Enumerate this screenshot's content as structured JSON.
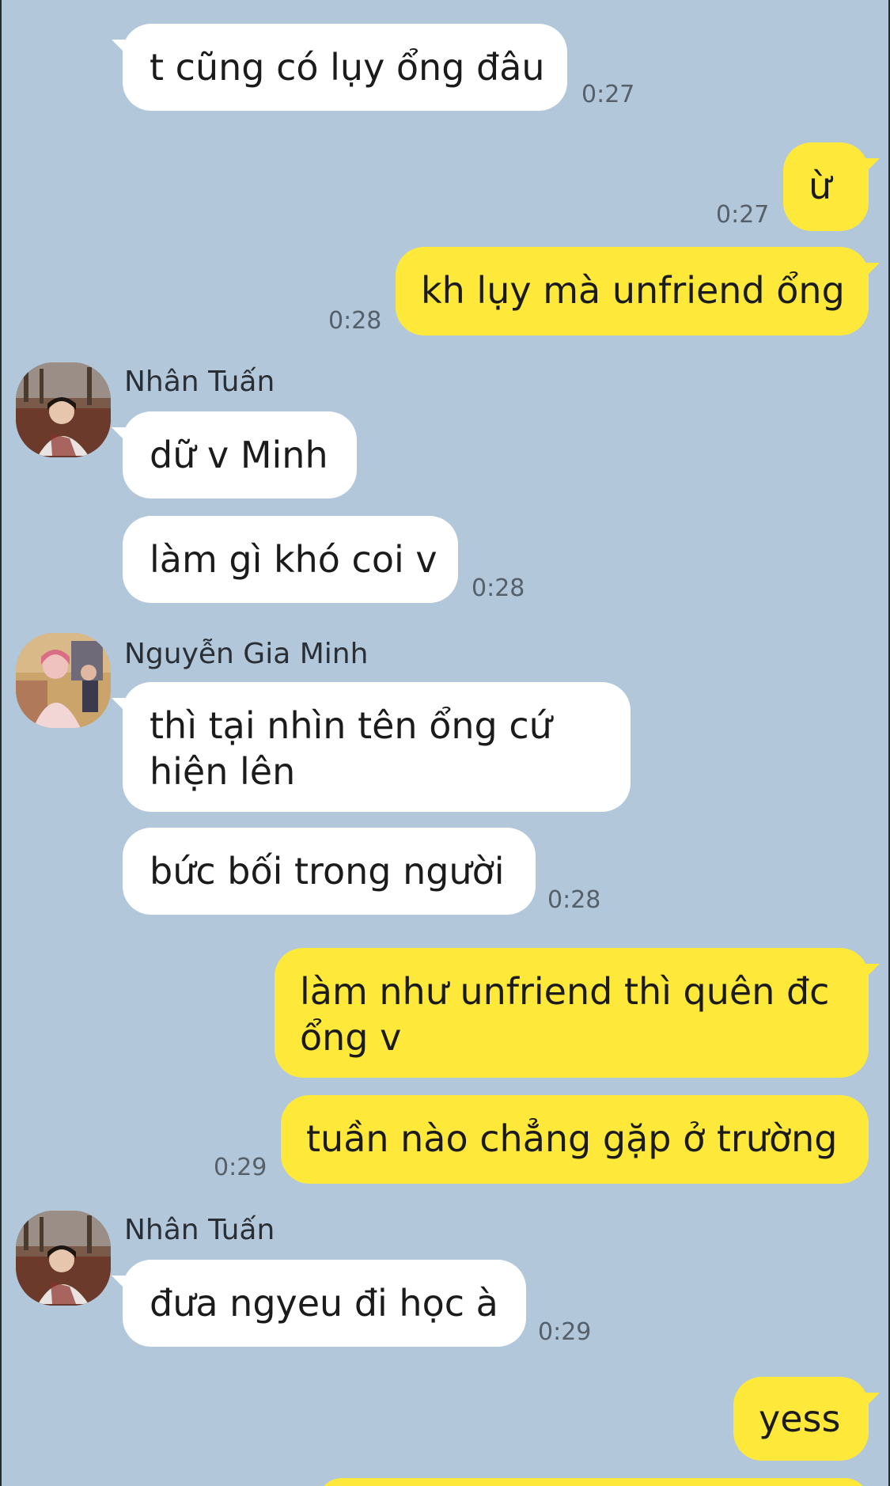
{
  "chat": {
    "messages": [
      {
        "text": "t cũng có lụy ổng đâu",
        "time": "0:27"
      },
      {
        "text": "ừ",
        "time": "0:27"
      },
      {
        "text": "kh lụy mà unfriend ổng",
        "time": "0:28"
      },
      {
        "sender": "Nhân Tuấn",
        "text": "dữ v Minh"
      },
      {
        "text": "làm gì khó coi v",
        "time": "0:28"
      },
      {
        "sender": "Nguyễn Gia Minh",
        "text": "thì tại nhìn tên ổng cứ hiện lên"
      },
      {
        "text": "bức bối trong người",
        "time": "0:28"
      },
      {
        "text": "làm như unfriend thì quên đc ổng v"
      },
      {
        "text": "tuần nào chẳng gặp ở trường",
        "time": "0:29"
      },
      {
        "sender": "Nhân Tuấn",
        "text": "đưa ngyeu đi học à",
        "time": "0:29"
      },
      {
        "text": "yess"
      }
    ]
  },
  "colors": {
    "background": "#b2c7da",
    "incoming_bubble": "#ffffff",
    "outgoing_bubble": "#fee93a"
  }
}
